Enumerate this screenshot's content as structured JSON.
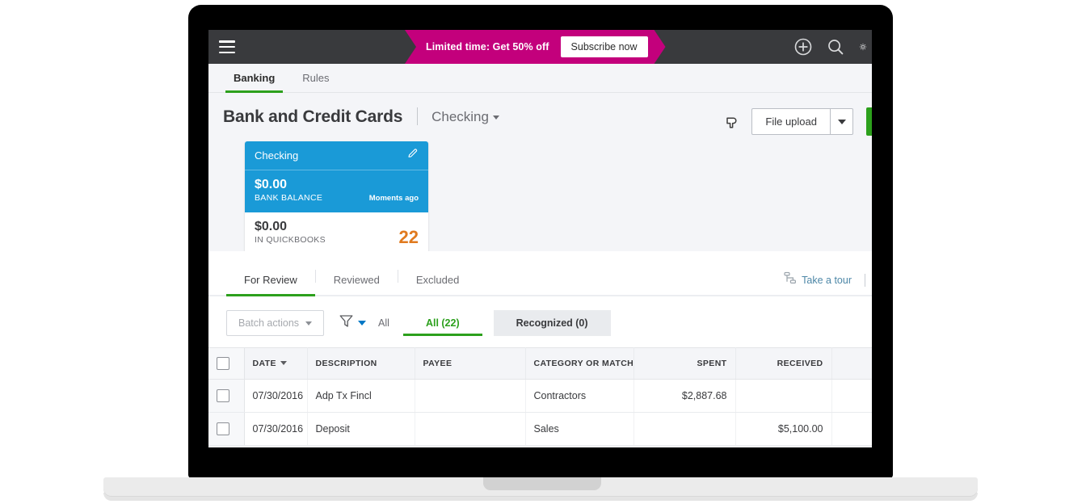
{
  "topbar": {
    "menu_icon": "hamburger-menu-icon",
    "promo_text": "Limited time: Get 50% off",
    "promo_button": "Subscribe now",
    "icons": [
      "plus-circle-icon",
      "search-icon",
      "gear-icon"
    ]
  },
  "nav": {
    "tabs": [
      {
        "label": "Banking",
        "active": true
      },
      {
        "label": "Rules",
        "active": false
      }
    ]
  },
  "header": {
    "title": "Bank and Credit Cards",
    "account_selector": "Checking",
    "cursor_icon": "pointing-hand-cursor-icon",
    "upload_button": "File upload",
    "upload_caret_icon": "chevron-down-icon"
  },
  "account_card": {
    "name": "Checking",
    "edit_icon": "pencil-edit-icon",
    "bank_balance_amount": "$0.00",
    "bank_balance_label": "BANK BALANCE",
    "sync_status": "Moments ago",
    "quickbooks_amount": "$0.00",
    "quickbooks_label": "IN QUICKBOOKS",
    "pending_count": "22"
  },
  "subtabs": [
    {
      "label": "For Review",
      "active": true
    },
    {
      "label": "Reviewed",
      "active": false
    },
    {
      "label": "Excluded",
      "active": false
    }
  ],
  "tour": {
    "icon": "sitemap-tour-icon",
    "label": "Take a tour"
  },
  "filters": {
    "batch_actions": "Batch actions",
    "funnel_icon": "filter-funnel-icon",
    "all_label": "All",
    "pills": [
      {
        "label": "All (22)",
        "active": true
      },
      {
        "label": "Recognized (0)",
        "active": false
      }
    ]
  },
  "table": {
    "columns": [
      "DATE",
      "DESCRIPTION",
      "PAYEE",
      "CATEGORY OR MATCH",
      "SPENT",
      "RECEIVED"
    ],
    "sort_column": "DATE",
    "rows": [
      {
        "date": "07/30/2016",
        "description": "Adp Tx Fincl",
        "payee": "",
        "category": "Contractors",
        "spent": "$2,887.68",
        "received": ""
      },
      {
        "date": "07/30/2016",
        "description": "Deposit",
        "payee": "",
        "category": "Sales",
        "spent": "",
        "received": "$5,100.00"
      }
    ]
  },
  "colors": {
    "promo_pink": "#c3007c",
    "topbar_dark": "#393a3d",
    "accent_green": "#2ca01c",
    "card_blue": "#1a9ad7",
    "count_orange": "#e07a1f",
    "link_blue": "#4d87a7"
  }
}
